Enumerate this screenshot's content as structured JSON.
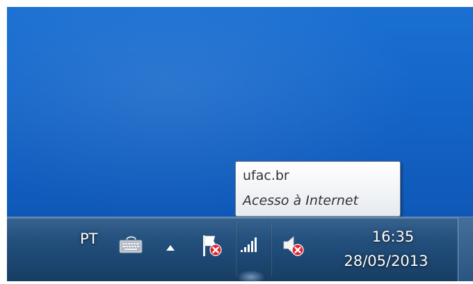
{
  "tooltip": {
    "network_name": "ufac.br",
    "status": "Acesso à Internet"
  },
  "taskbar": {
    "language": "PT",
    "clock": {
      "time": "16:35",
      "date": "28/05/2013"
    },
    "tray_icons": [
      {
        "name": "keyboard-icon"
      },
      {
        "name": "show-hidden-icons-arrow-icon"
      },
      {
        "name": "action-center-flag-error-icon"
      },
      {
        "name": "network-signal-icon"
      },
      {
        "name": "volume-muted-icon"
      }
    ]
  },
  "colors": {
    "desktop": "#1465c8",
    "taskbar": "#24507e",
    "tooltip_bg": "#ffffff",
    "error_badge": "#e0242b"
  }
}
